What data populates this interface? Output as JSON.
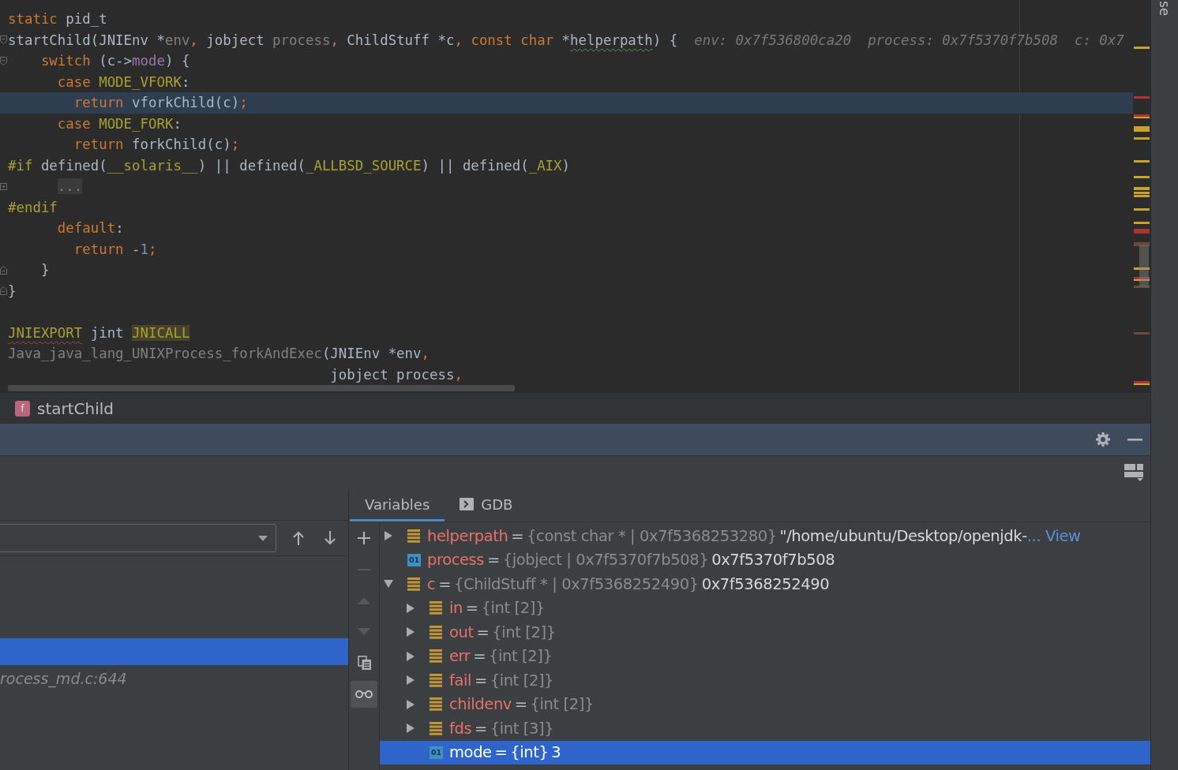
{
  "editor": {
    "lines": [
      {
        "current": false,
        "tokens": [
          {
            "text": "static",
            "kind": "keyword"
          },
          {
            "text": " pid_t",
            "kind": "plain"
          }
        ]
      },
      {
        "current": false,
        "fold_marker": {
          "kind": "open"
        },
        "tokens": [
          {
            "text": "startChild(JNIEnv *",
            "kind": "plain"
          },
          {
            "text": "env",
            "kind": "unused"
          },
          {
            "text": ",",
            "kind": "keyword"
          },
          {
            "text": " jobject ",
            "kind": "plain"
          },
          {
            "text": "process",
            "kind": "unused"
          },
          {
            "text": ",",
            "kind": "keyword"
          },
          {
            "text": " ChildStuff *c",
            "kind": "plain"
          },
          {
            "text": ",",
            "kind": "keyword"
          },
          {
            "text": " const char",
            "kind": "keyword"
          },
          {
            "text": " *",
            "kind": "plain"
          },
          {
            "text": "helperpath",
            "kind": "plain",
            "squiggle": {
              "kind": "typo"
            }
          },
          {
            "text": ") {",
            "kind": "plain"
          }
        ],
        "hints": [
          "env: 0x7f536800ca20",
          "process: 0x7f5370f7b508",
          "c: 0x7"
        ]
      },
      {
        "current": false,
        "fold_marker": {
          "kind": "open"
        },
        "tokens": [
          {
            "text": "    switch",
            "kind": "keyword"
          },
          {
            "text": " (c->",
            "kind": "plain"
          },
          {
            "text": "mode",
            "kind": "field"
          },
          {
            "text": ") {",
            "kind": "plain"
          }
        ]
      },
      {
        "current": false,
        "tokens": [
          {
            "text": "      case ",
            "kind": "keyword"
          },
          {
            "text": "MODE_VFORK",
            "kind": "macro"
          },
          {
            "text": ":",
            "kind": "plain"
          }
        ]
      },
      {
        "current": true,
        "tokens": [
          {
            "text": "        return ",
            "kind": "keyword"
          },
          {
            "text": "vforkChild(c)",
            "kind": "plain"
          },
          {
            "text": ";",
            "kind": "keyword"
          }
        ]
      },
      {
        "current": false,
        "tokens": [
          {
            "text": "      case ",
            "kind": "keyword"
          },
          {
            "text": "MODE_FORK",
            "kind": "macro"
          },
          {
            "text": ":",
            "kind": "plain"
          }
        ]
      },
      {
        "current": false,
        "tokens": [
          {
            "text": "        return ",
            "kind": "keyword"
          },
          {
            "text": "forkChild(c)",
            "kind": "plain"
          },
          {
            "text": ";",
            "kind": "keyword"
          }
        ]
      },
      {
        "current": false,
        "tokens": [
          {
            "text": "#if",
            "kind": "macro"
          },
          {
            "text": " defined(",
            "kind": "plain"
          },
          {
            "text": "__solaris__",
            "kind": "macro"
          },
          {
            "text": ") || defined(",
            "kind": "plain"
          },
          {
            "text": "_ALLBSD_SOURCE",
            "kind": "macro"
          },
          {
            "text": ") || defined(",
            "kind": "plain"
          },
          {
            "text": "_AIX",
            "kind": "macro"
          },
          {
            "text": ")",
            "kind": "plain"
          }
        ]
      },
      {
        "current": false,
        "fold_marker": {
          "kind": "collapsed"
        },
        "tokens": [
          {
            "text": "      ...",
            "kind": "folded"
          }
        ]
      },
      {
        "current": false,
        "tokens": [
          {
            "text": "#endif",
            "kind": "macro"
          }
        ]
      },
      {
        "current": false,
        "tokens": [
          {
            "text": "      default",
            "kind": "keyword"
          },
          {
            "text": ":",
            "kind": "plain"
          }
        ]
      },
      {
        "current": false,
        "tokens": [
          {
            "text": "        return ",
            "kind": "keyword"
          },
          {
            "text": "-",
            "kind": "plain"
          },
          {
            "text": "1",
            "kind": "number"
          },
          {
            "text": ";",
            "kind": "keyword"
          }
        ]
      },
      {
        "current": false,
        "fold_marker": {
          "kind": "close"
        },
        "tokens": [
          {
            "text": "    }",
            "kind": "plain"
          }
        ]
      },
      {
        "current": false,
        "fold_marker": {
          "kind": "close"
        },
        "tokens": [
          {
            "text": "}",
            "kind": "plain"
          }
        ]
      },
      {
        "current": false
      },
      {
        "current": false,
        "tokens": [
          {
            "text": "JNIEXPORT",
            "kind": "macro",
            "squiggle": {
              "kind": "error"
            }
          },
          {
            "text": " jint ",
            "kind": "plain"
          },
          {
            "text": "JNICALL",
            "kind": "macro",
            "marked": true
          }
        ]
      },
      {
        "current": false,
        "tokens": [
          {
            "text": "Java_java_lang_UNIXProcess_forkAndExec",
            "kind": "unused"
          },
          {
            "text": "(JNIEnv *env",
            "kind": "plain"
          },
          {
            "text": ",",
            "kind": "keyword"
          }
        ]
      },
      {
        "current": false,
        "tokens": [
          {
            "text": "                                       jobject process",
            "kind": "plain"
          },
          {
            "text": ",",
            "kind": "keyword"
          }
        ]
      }
    ],
    "error_stripe": [
      {
        "color": "#c9a227"
      },
      {
        "color": "#b03232"
      },
      {
        "color": "#b03232"
      },
      {
        "color": "#c9a227"
      },
      {
        "color": "#c9a227"
      },
      {
        "color": "#c9a227"
      },
      {
        "color": "#c9a227"
      },
      {
        "color": "#c9a227"
      },
      {
        "color": "#c9a227"
      },
      {
        "color": "#c9a227"
      },
      {
        "color": "#c9a227"
      },
      {
        "color": "#c9a227"
      },
      {
        "color": "#c9a227"
      },
      {
        "color": "#b03232"
      },
      {
        "color": "#6d4a3c"
      },
      {
        "color": "#c9a227"
      },
      {
        "color": "#b03232"
      },
      {
        "color": "#c9a227"
      },
      {
        "color": "#6d4a3c"
      },
      {
        "color": "#6d4a3c"
      },
      {
        "color": "#b03232"
      },
      {
        "color": "#c9a227"
      }
    ]
  },
  "breadcrumb": {
    "badge": "f",
    "label": "startChild"
  },
  "frames": {
    "items": [
      {
        "selected": true
      },
      {
        "location": "rocess_md.c:644",
        "selected": false
      }
    ]
  },
  "variables_panel": {
    "tabs": [
      {
        "label": "Variables",
        "kind": "plain",
        "selected": true
      },
      {
        "label": "GDB",
        "kind": "console",
        "selected": false
      }
    ],
    "watch_toolbar": [
      {
        "kind": "add",
        "disabled": false,
        "on": false
      },
      {
        "kind": "remove",
        "disabled": true,
        "on": false
      },
      {
        "kind": "move_up",
        "disabled": true,
        "on": false
      },
      {
        "kind": "move_down",
        "disabled": true,
        "on": false
      },
      {
        "kind": "duplicate",
        "disabled": false,
        "on": false
      },
      {
        "kind": "show_values",
        "disabled": false,
        "on": true
      }
    ],
    "tree": [
      {
        "name": "helperpath",
        "op": "=",
        "type": "{const char * | 0x7f5368253280}",
        "value": "\"/home/ubuntu/Desktop/openjdk-",
        "link": "... View",
        "kind": "struct",
        "expandable": true,
        "expanded": false,
        "selected": false
      },
      {
        "name": "process",
        "op": "=",
        "type": "{jobject | 0x7f5370f7b508}",
        "value": "0x7f5370f7b508",
        "kind": "primitive",
        "badge": "01",
        "expandable": false,
        "selected": false
      },
      {
        "name": "c",
        "op": "=",
        "type": "{ChildStuff * | 0x7f5368252490}",
        "value": "0x7f5368252490",
        "kind": "struct",
        "expandable": true,
        "expanded": true,
        "selected": false,
        "children": [
          {
            "name": "in",
            "op": "=",
            "type": "{int [2]}",
            "kind": "struct",
            "expandable": true,
            "expanded": false,
            "selected": false
          },
          {
            "name": "out",
            "op": "=",
            "type": "{int [2]}",
            "kind": "struct",
            "expandable": true,
            "expanded": false,
            "selected": false
          },
          {
            "name": "err",
            "op": "=",
            "type": "{int [2]}",
            "kind": "struct",
            "expandable": true,
            "expanded": false,
            "selected": false
          },
          {
            "name": "fail",
            "op": "=",
            "type": "{int [2]}",
            "kind": "struct",
            "expandable": true,
            "expanded": false,
            "selected": false
          },
          {
            "name": "childenv",
            "op": "=",
            "type": "{int [2]}",
            "kind": "struct",
            "expandable": true,
            "expanded": false,
            "selected": false
          },
          {
            "name": "fds",
            "op": "=",
            "type": "{int [3]}",
            "kind": "struct",
            "expandable": true,
            "expanded": false,
            "selected": false
          },
          {
            "name": "mode",
            "op": "=",
            "type": "{int}",
            "value": "3",
            "kind": "primitive",
            "badge": "01",
            "expandable": false,
            "selected": true
          }
        ]
      }
    ]
  },
  "side_strip": {
    "label": "se"
  }
}
